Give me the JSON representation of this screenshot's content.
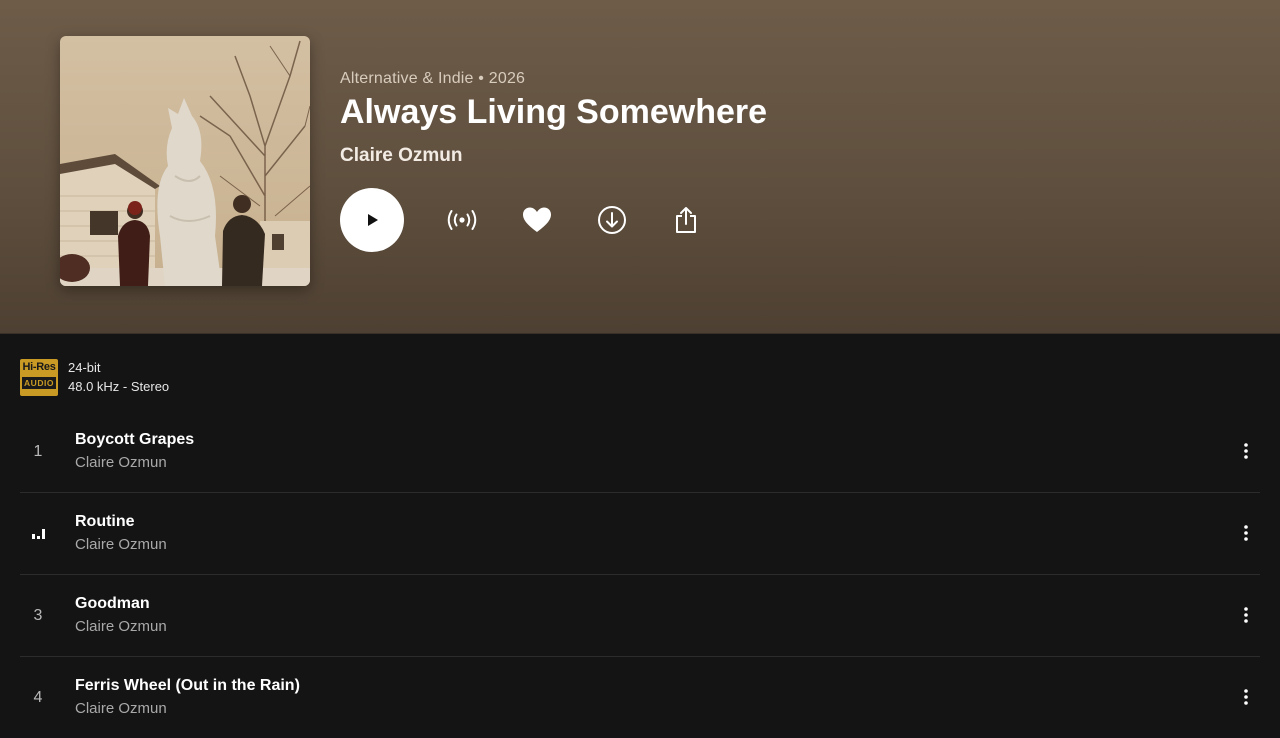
{
  "album": {
    "genre_year": "Alternative & Indie • 2026",
    "title": "Always Living Somewhere",
    "artist": "Claire Ozmun"
  },
  "quality": {
    "badge_top": "Hi-Res",
    "badge_bottom": "AUDIO",
    "bit_depth": "24-bit",
    "sample_rate": "48.0 kHz - Stereo"
  },
  "tracks": [
    {
      "number": "1",
      "title": "Boycott Grapes",
      "artist": "Claire Ozmun"
    },
    {
      "number": "",
      "title": "Routine",
      "artist": "Claire Ozmun",
      "playing": true
    },
    {
      "number": "3",
      "title": "Goodman",
      "artist": "Claire Ozmun"
    },
    {
      "number": "4",
      "title": "Ferris Wheel (Out in the Rain)",
      "artist": "Claire Ozmun"
    }
  ],
  "icons": {
    "play": "play-icon",
    "radio": "radio-broadcast-icon",
    "favorite": "heart-icon",
    "download": "download-icon",
    "share": "share-icon",
    "more": "more-vertical-icon",
    "now_playing": "equalizer-icon"
  },
  "colors": {
    "header_gradient_top": "#6e5c49",
    "header_gradient_bottom": "#4e4032",
    "background": "#141414",
    "hires_gold": "#c99a24"
  }
}
